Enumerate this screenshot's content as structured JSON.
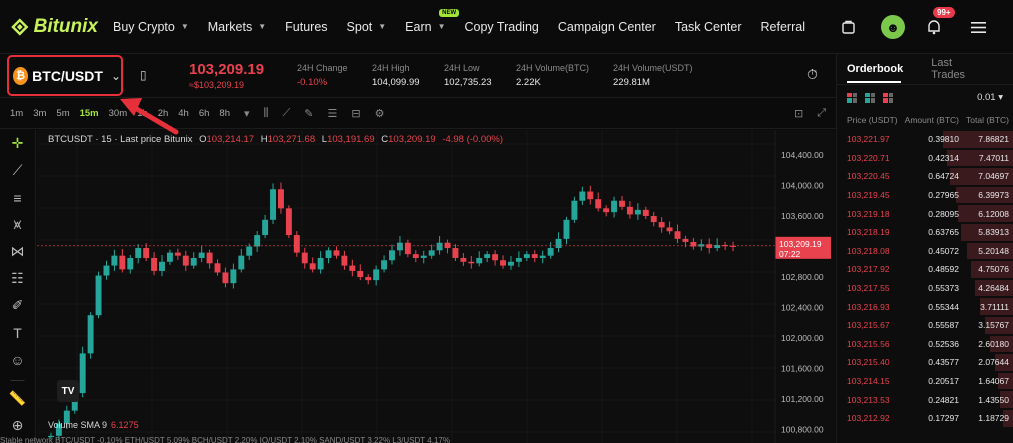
{
  "nav": {
    "logo": "Bitunix",
    "menu": [
      {
        "label": "Buy Crypto",
        "dropdown": true
      },
      {
        "label": "Markets",
        "dropdown": true
      },
      {
        "label": "Futures",
        "dropdown": false
      },
      {
        "label": "Spot",
        "dropdown": true
      },
      {
        "label": "Earn",
        "dropdown": true,
        "badge": "NEW"
      },
      {
        "label": "Copy Trading",
        "dropdown": false
      },
      {
        "label": "Campaign Center",
        "dropdown": false
      },
      {
        "label": "Task Center",
        "dropdown": false
      },
      {
        "label": "Referral",
        "dropdown": false
      }
    ],
    "notification_count": "99+"
  },
  "ticker": {
    "pair": "BTC/USDT",
    "last_price": "103,209.19",
    "last_price_usd": "≈$103,209.19",
    "stats": [
      {
        "label": "24H Change",
        "value": "-0.10%",
        "negative": true
      },
      {
        "label": "24H High",
        "value": "104,099.99",
        "negative": false
      },
      {
        "label": "24H Low",
        "value": "102,735.23",
        "negative": false
      },
      {
        "label": "24H Volume(BTC)",
        "value": "2.22K",
        "negative": false
      },
      {
        "label": "24H Volume(USDT)",
        "value": "229.81M",
        "negative": false
      }
    ]
  },
  "intervals": [
    "1m",
    "3m",
    "5m",
    "15m",
    "30m",
    "1h",
    "2h",
    "4h",
    "6h",
    "8h"
  ],
  "active_interval": "15m",
  "chart": {
    "legend_symbol": "BTCUSDT · 15 · Last price Bitunix",
    "ohlc": {
      "o": "103,214.17",
      "h": "103,271.68",
      "l": "103,191.69",
      "c": "103,209.19",
      "change": "-4.98 (-0.00%)"
    },
    "price_axis": [
      "104,400.00",
      "104,000.00",
      "103,600.00",
      "102,800.00",
      "102,400.00",
      "102,000.00",
      "101,600.00",
      "101,200.00",
      "100,800.00"
    ],
    "current_price_label": "103,209.19",
    "countdown": "07:22",
    "sma_label": "Volume SMA 9",
    "sma_value": "6.1275",
    "watermark": "TV"
  },
  "chart_data": {
    "type": "line",
    "title": "",
    "xlabel": "",
    "ylabel": "",
    "ylim": [
      100600,
      104700
    ],
    "series": [
      {
        "values": [
          100720,
          100880,
          101050,
          101280,
          101800,
          102300,
          102820,
          102950,
          103080,
          102900,
          103050,
          103180,
          103050,
          102880,
          103000,
          103120,
          103080,
          102950,
          103050,
          103120,
          102980,
          102860,
          102720,
          102900,
          103080,
          103200,
          103350,
          103550,
          103950,
          103700,
          103350,
          103120,
          102980,
          102900,
          103050,
          103150,
          103080,
          102950,
          102880,
          102800,
          102760,
          102900,
          103020,
          103150,
          103250,
          103100,
          103050,
          103080,
          103150,
          103250,
          103180,
          103050,
          103000,
          102980,
          103050,
          103100,
          103020,
          102950,
          103000,
          103050,
          103100,
          103050,
          103080,
          103180,
          103300,
          103550,
          103800,
          103920,
          103820,
          103700,
          103650,
          103800,
          103720,
          103620,
          103680,
          103600,
          103520,
          103450,
          103400,
          103300,
          103260,
          103200,
          103230,
          103180,
          103220,
          103210,
          103209
        ]
      }
    ]
  },
  "orderbook": {
    "tabs": [
      "Orderbook",
      "Last Trades"
    ],
    "precision": "0.01",
    "headers": [
      "Price (USDT)",
      "Amount (BTC)",
      "Total (BTC)"
    ],
    "asks": [
      {
        "price": "103,221.97",
        "amount": "0.39810",
        "total": "7.86821",
        "depth": 1.0
      },
      {
        "price": "103,220.71",
        "amount": "0.42314",
        "total": "7.47011",
        "depth": 0.95
      },
      {
        "price": "103,220.45",
        "amount": "0.64724",
        "total": "7.04697",
        "depth": 0.9
      },
      {
        "price": "103,219.45",
        "amount": "0.27965",
        "total": "6.39973",
        "depth": 0.81
      },
      {
        "price": "103,219.18",
        "amount": "0.28095",
        "total": "6.12008",
        "depth": 0.78
      },
      {
        "price": "103,218.19",
        "amount": "0.63765",
        "total": "5.83913",
        "depth": 0.74
      },
      {
        "price": "103,218.08",
        "amount": "0.45072",
        "total": "5.20148",
        "depth": 0.66
      },
      {
        "price": "103,217.92",
        "amount": "0.48592",
        "total": "4.75076",
        "depth": 0.6
      },
      {
        "price": "103,217.55",
        "amount": "0.55373",
        "total": "4.26484",
        "depth": 0.54
      },
      {
        "price": "103,216.93",
        "amount": "0.55344",
        "total": "3.71111",
        "depth": 0.47
      },
      {
        "price": "103,215.67",
        "amount": "0.55587",
        "total": "3.15767",
        "depth": 0.4
      },
      {
        "price": "103,215.56",
        "amount": "0.52536",
        "total": "2.60180",
        "depth": 0.33
      },
      {
        "price": "103,215.40",
        "amount": "0.43577",
        "total": "2.07644",
        "depth": 0.26
      },
      {
        "price": "103,214.15",
        "amount": "0.20517",
        "total": "1.64067",
        "depth": 0.21
      },
      {
        "price": "103,213.53",
        "amount": "0.24821",
        "total": "1.43550",
        "depth": 0.18
      },
      {
        "price": "103,212.92",
        "amount": "0.17297",
        "total": "1.18729",
        "depth": 0.15
      }
    ]
  },
  "strip": "Stable network  BTC/USDT -0.10%  ETH/USDT 5.09%  BCH/USDT 2.20%  IO/USDT 2.10%  SAND/USDT 3.22%  L3/USDT 4.17%",
  "colors": {
    "accent": "#a3e635",
    "down": "#e8424e",
    "up": "#26a69a",
    "annotation": "#e5303a"
  }
}
